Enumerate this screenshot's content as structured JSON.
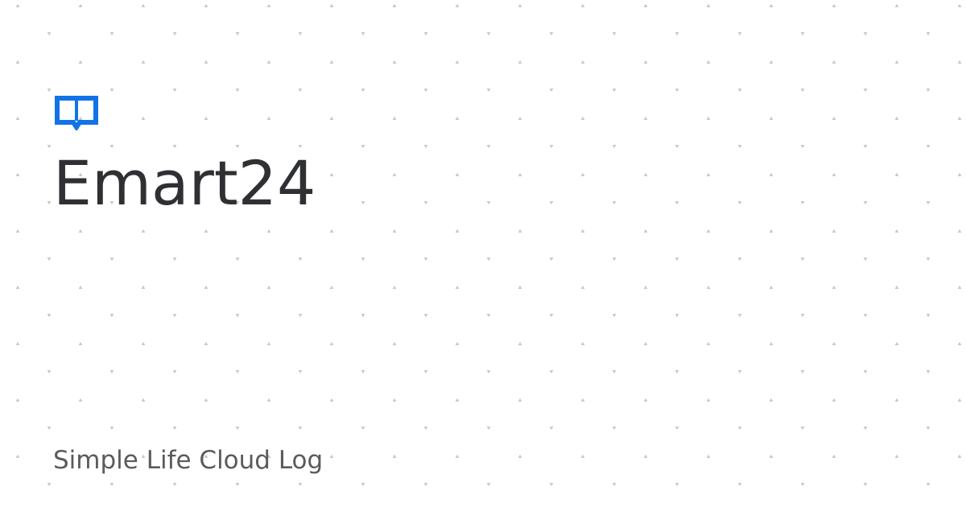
{
  "page": {
    "title": "Emart24",
    "site_name": "Simple Life Cloud Log"
  },
  "icons": {
    "logo": "open-book-icon"
  },
  "colors": {
    "background": "#ffffff",
    "title": "#2f3033",
    "subtitle": "#5a5b5e",
    "accent": "#1273e6",
    "pattern": "#c9c9c9"
  }
}
